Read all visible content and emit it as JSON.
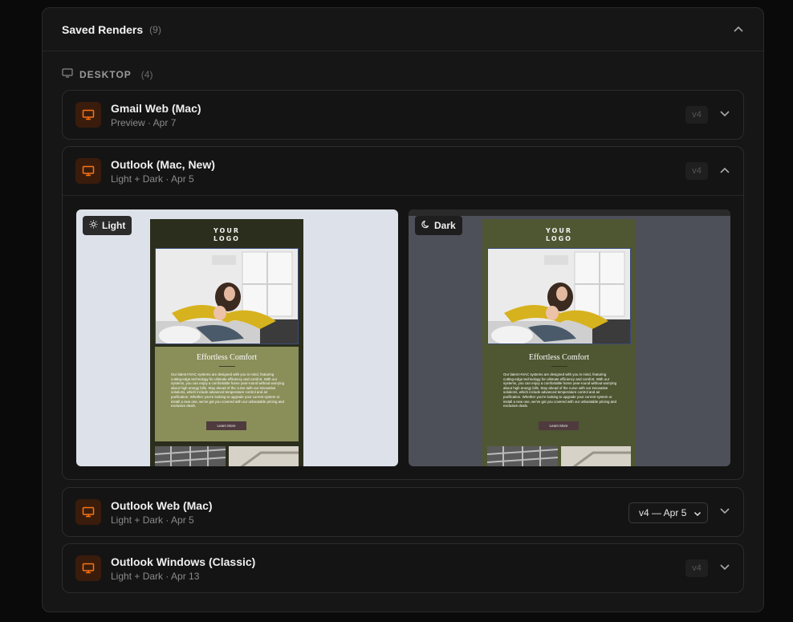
{
  "panel": {
    "title": "Saved Renders",
    "count": "(9)"
  },
  "section": {
    "title": "DESKTOP",
    "count": "(4)",
    "icon": "monitor-icon"
  },
  "renders": [
    {
      "name": "Gmail Web (Mac)",
      "subtitle": "Preview · Apr 7",
      "version": "v4",
      "expanded": false
    },
    {
      "name": "Outlook (Mac, New)",
      "subtitle": "Light + Dark · Apr 5",
      "version": "v4",
      "expanded": true
    },
    {
      "name": "Outlook Web (Mac)",
      "subtitle": "Light + Dark · Apr 5",
      "version_select": "v4 — Apr 5",
      "expanded": false
    },
    {
      "name": "Outlook Windows (Classic)",
      "subtitle": "Light + Dark · Apr 13",
      "version": "v4",
      "expanded": false
    }
  ],
  "modes": {
    "light": "Light",
    "dark": "Dark"
  },
  "email": {
    "logo_line1": "YOUR",
    "logo_line2": "LOGO",
    "heading": "Effortless Comfort",
    "body": "Our latest HVAC systems are designed with you in mind, featuring cutting-edge technology for ultimate efficiency and comfort. With our systems, you can enjoy a comfortable home year-round without worrying about high energy bills. Stay ahead of the curve with our innovative solutions, which include advanced temperature control and air purification. Whether you're looking to upgrade your current system or install a new one, we've got you covered with our unbeatable pricing and exclusive deals.",
    "button": "Learn More"
  },
  "colors": {
    "accent": "#f97316",
    "icon_bg": "#3a1c0c"
  }
}
